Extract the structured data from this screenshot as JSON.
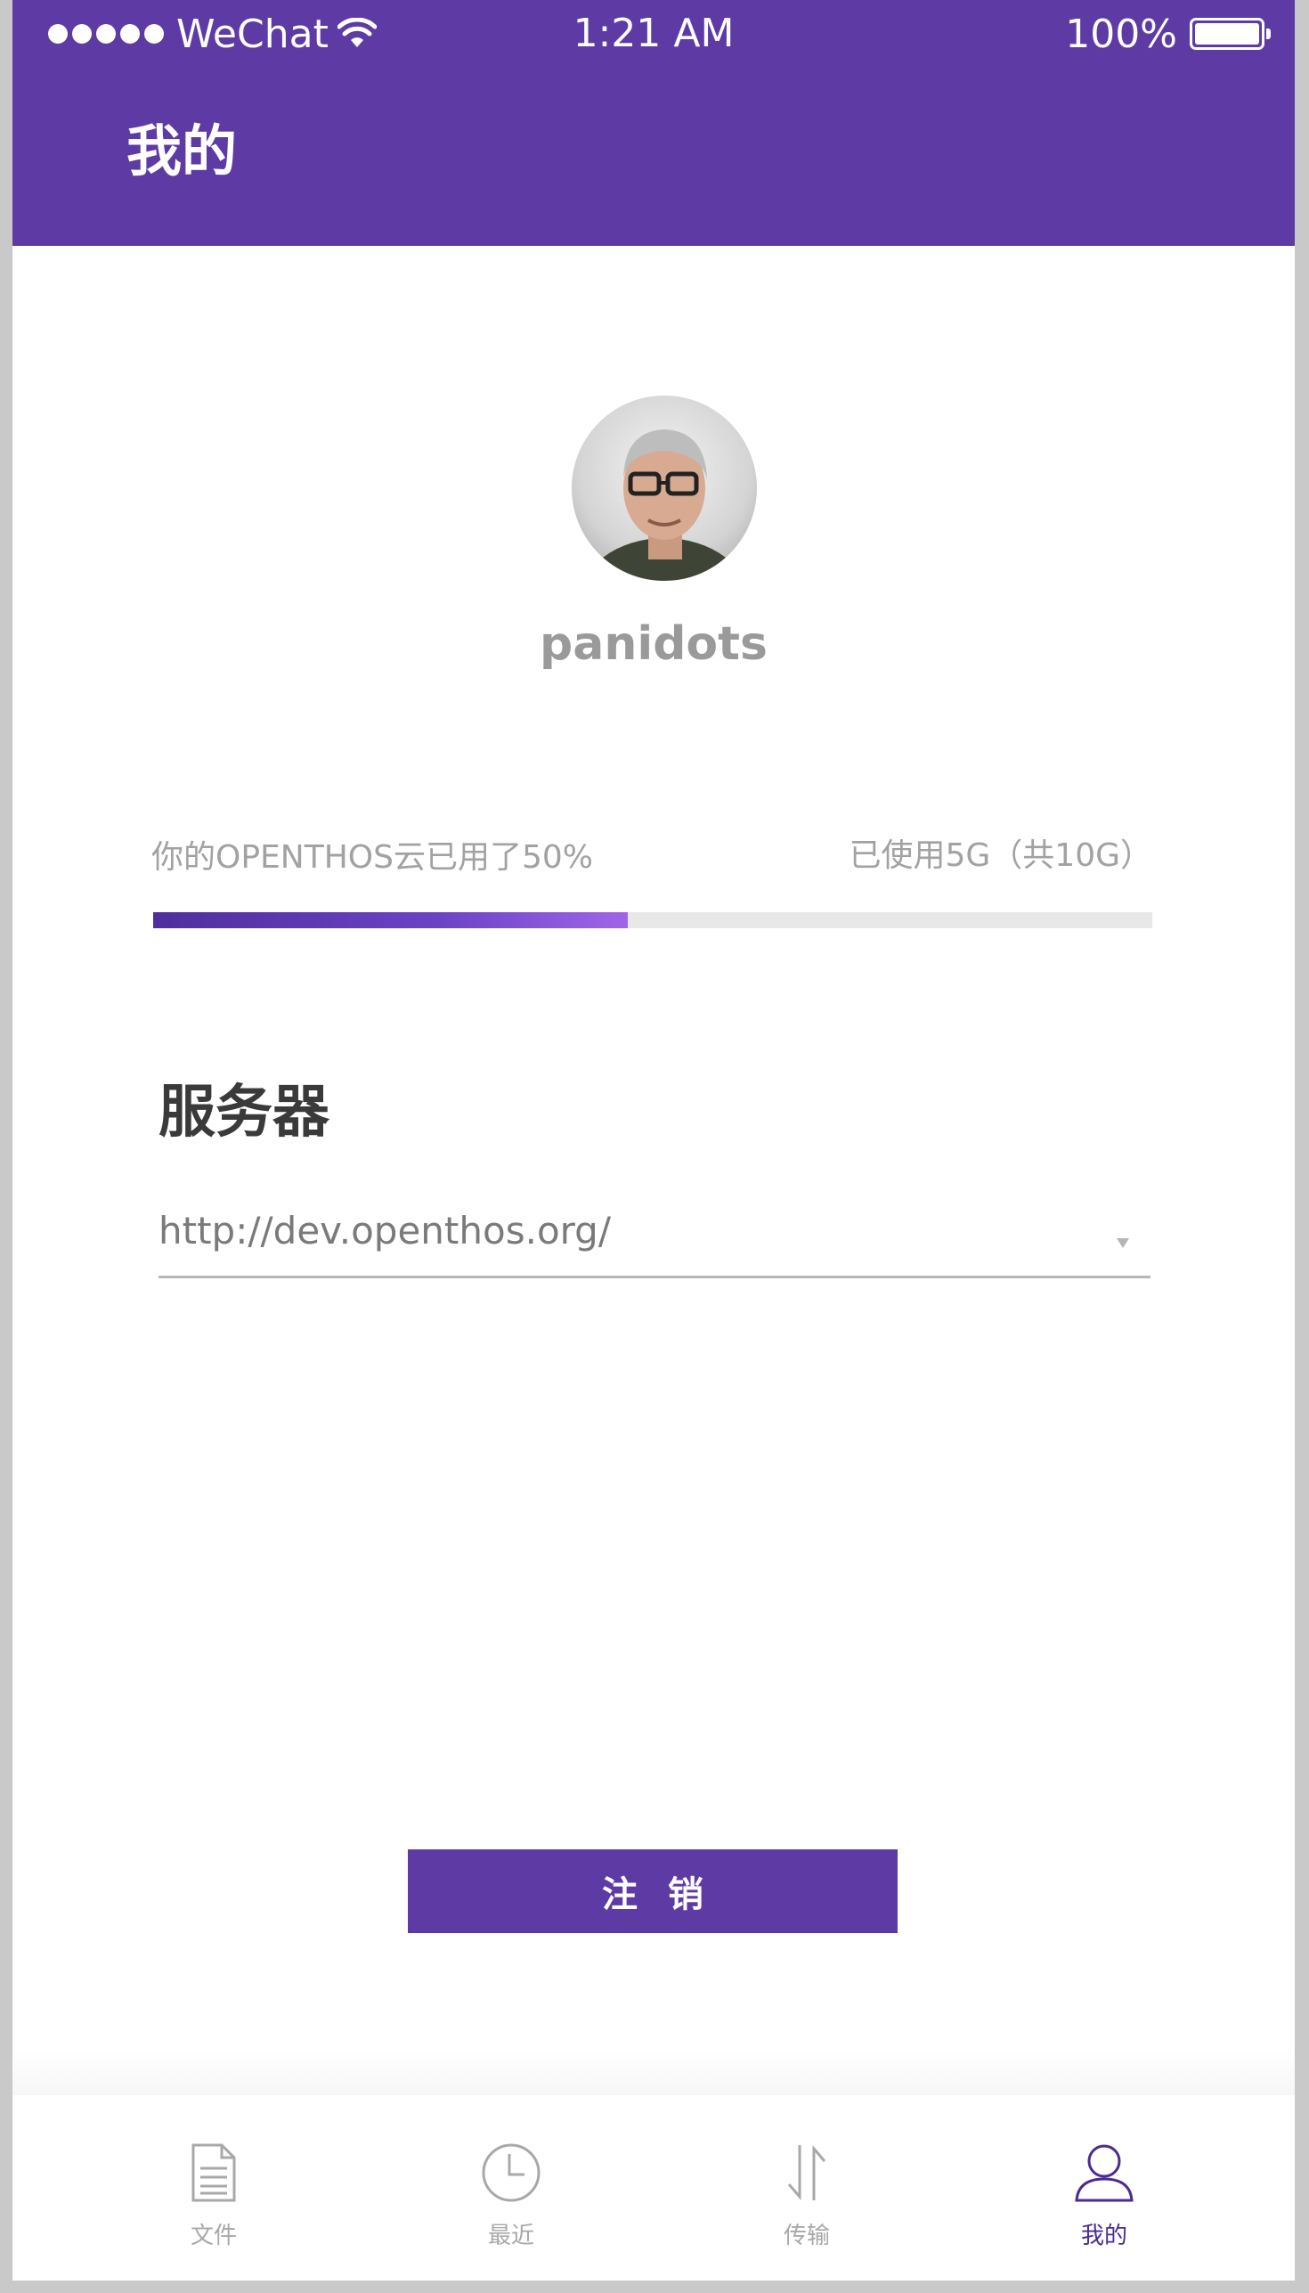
{
  "status_bar": {
    "carrier": "WeChat",
    "time": "1:21 AM",
    "battery": "100%"
  },
  "nav": {
    "title": "我的"
  },
  "profile": {
    "username": "panidots"
  },
  "storage": {
    "usage_text": "你的OPENTHOS云已用了50%",
    "quota_text": "已使用5G（共10G）",
    "used_fraction": 0.5
  },
  "server": {
    "title": "服务器",
    "selected_value": "http://dev.openthos.org/"
  },
  "logout": {
    "label": "注销"
  },
  "tabs": [
    {
      "label": "文件",
      "icon": "document-icon"
    },
    {
      "label": "最近",
      "icon": "clock-icon"
    },
    {
      "label": "传输",
      "icon": "transfer-arrows-icon"
    },
    {
      "label": "我的",
      "icon": "person-icon",
      "active": true
    }
  ],
  "colors": {
    "brand": "#5e3aa5",
    "active_tab": "#4a2a94",
    "inactive_tab": "#a8a8a8"
  }
}
